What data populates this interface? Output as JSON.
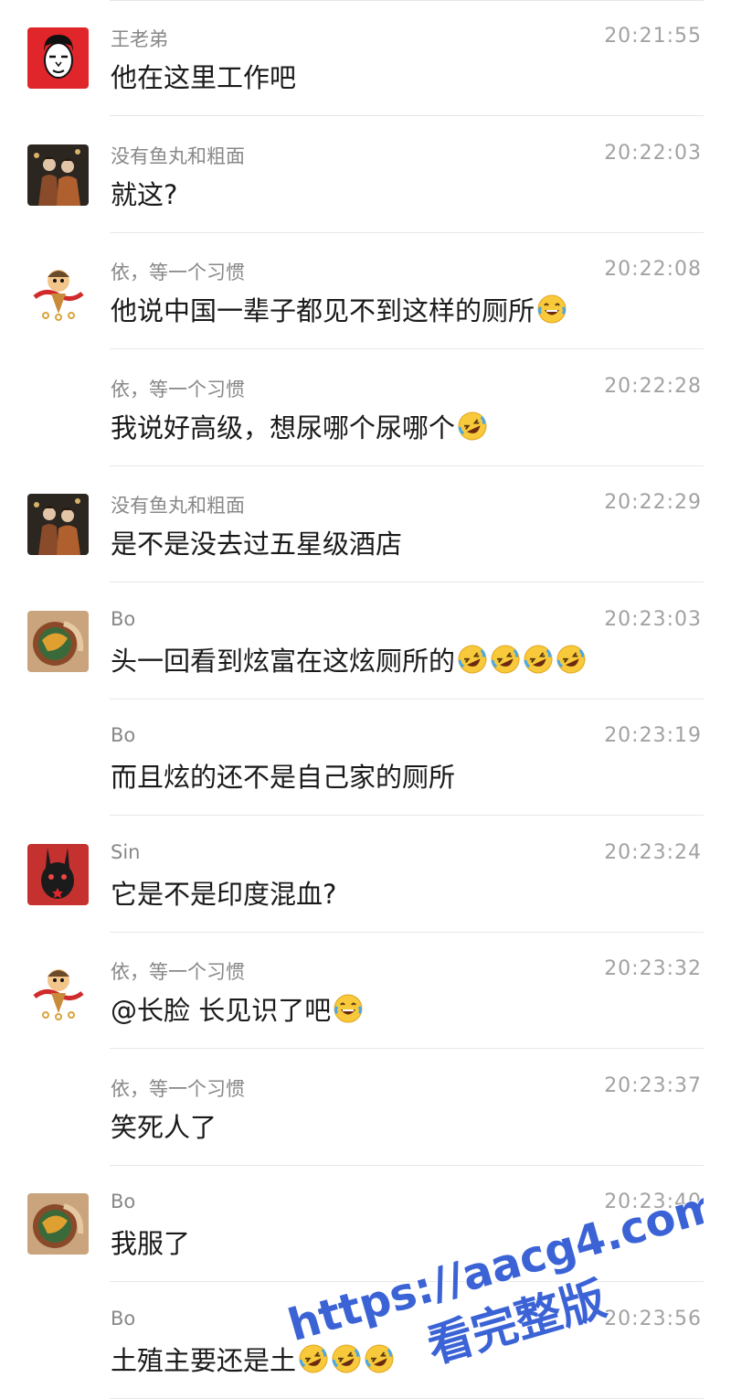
{
  "messages": [
    {
      "name": "王老弟",
      "time": "20:21:55",
      "text": "他在这里工作吧",
      "emojis": [],
      "avatar": "red-face"
    },
    {
      "name": "没有鱼丸和粗面",
      "time": "20:22:03",
      "text": "就这?",
      "emojis": [],
      "avatar": "photo-people"
    },
    {
      "name": "依，等一个习惯",
      "time": "20:22:08",
      "text": "他说中国一辈子都见不到这样的厕所",
      "emojis": [
        "joy"
      ],
      "avatar": "monkey-king"
    },
    {
      "name": "依，等一个习惯",
      "time": "20:22:28",
      "text": "我说好高级，想尿哪个尿哪个",
      "emojis": [
        "rofl"
      ],
      "avatar": ""
    },
    {
      "name": "没有鱼丸和粗面",
      "time": "20:22:29",
      "text": "是不是没去过五星级酒店",
      "emojis": [],
      "avatar": "photo-people"
    },
    {
      "name": "Bo",
      "time": "20:23:03",
      "text": "头一回看到炫富在这炫厕所的",
      "emojis": [
        "rofl",
        "rofl",
        "rofl",
        "rofl"
      ],
      "avatar": "food-bowl"
    },
    {
      "name": "Bo",
      "time": "20:23:19",
      "text": "而且炫的还不是自己家的厕所",
      "emojis": [],
      "avatar": ""
    },
    {
      "name": "Sin",
      "time": "20:23:24",
      "text": "它是不是印度混血?",
      "emojis": [],
      "avatar": "dark-rabbit"
    },
    {
      "name": "依，等一个习惯",
      "time": "20:23:32",
      "text": "@长脸 长见识了吧",
      "emojis": [
        "joy"
      ],
      "avatar": "monkey-king"
    },
    {
      "name": "依，等一个习惯",
      "time": "20:23:37",
      "text": "笑死人了",
      "emojis": [],
      "avatar": ""
    },
    {
      "name": "Bo",
      "time": "20:23:40",
      "text": "我服了",
      "emojis": [],
      "avatar": "food-bowl"
    },
    {
      "name": "Bo",
      "time": "20:23:56",
      "text": "土殖主要还是土",
      "emojis": [
        "rofl",
        "rofl",
        "rofl"
      ],
      "avatar": ""
    }
  ],
  "watermark": {
    "line1": "https://aacg4.com",
    "line2": "看完整版",
    "color": "#3b63d6"
  },
  "colors": {
    "name": "#888888",
    "time": "#a2a2a2",
    "text": "#1a1a1a",
    "divider": "#e8e8e8"
  }
}
